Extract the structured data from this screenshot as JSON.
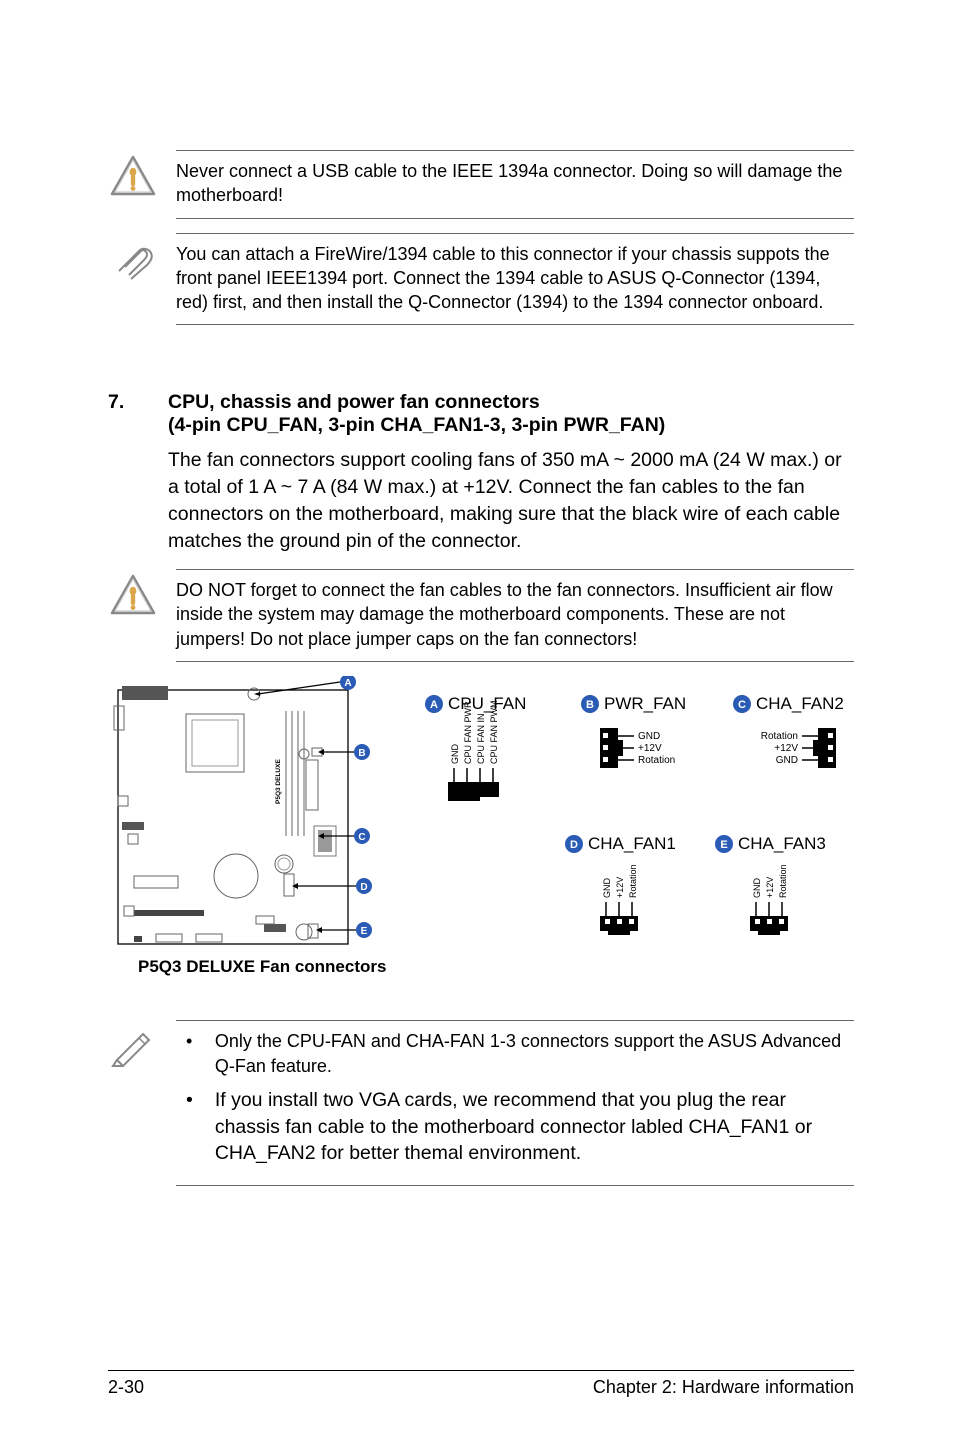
{
  "warning_usb_1394": "Never connect a USB cable to the IEEE 1394a connector. Doing so will damage the motherboard!",
  "note_firewire": "You can attach a FireWire/1394 cable to this connector if your chassis suppots the front panel IEEE1394 port. Connect the 1394 cable to ASUS Q-Connector (1394, red) first, and then install the Q-Connector (1394) to the 1394 connector onboard.",
  "section": {
    "number": "7.",
    "title_line1": "CPU, chassis and power fan connectors",
    "title_line2": "(4-pin CPU_FAN, 3-pin CHA_FAN1-3, 3-pin PWR_FAN)"
  },
  "body_fan": "The fan connectors support cooling fans of 350 mA ~ 2000 mA (24 W max.) or a total of 1 A ~ 7 A (84 W max.) at +12V. Connect the fan cables to the fan connectors on the motherboard, making sure that the black wire of each cable matches the ground pin of the connector.",
  "warning_do_not_forget": "DO NOT forget to connect the fan cables to the fan connectors. Insufficient air flow inside the system may damage the motherboard components. These are not jumpers! Do not place jumper caps on the fan connectors!",
  "figure": {
    "caption": "P5Q3 DELUXE Fan connectors",
    "board_label": "P5Q3 DELUXE",
    "callouts": [
      "A",
      "B",
      "C",
      "D",
      "E"
    ],
    "connectors": {
      "A": {
        "name": "CPU_FAN",
        "pins": [
          "GND",
          "CPU FAN PWR",
          "CPU FAN IN",
          "CPU FAN PWM"
        ]
      },
      "B": {
        "name": "PWR_FAN",
        "pins": [
          "GND",
          "+12V",
          "Rotation"
        ]
      },
      "C": {
        "name": "CHA_FAN2",
        "pins": [
          "Rotation",
          "+12V",
          "GND"
        ]
      },
      "D": {
        "name": "CHA_FAN1",
        "pins": [
          "GND",
          "+12V",
          "Rotation"
        ]
      },
      "E": {
        "name": "CHA_FAN3",
        "pins": [
          "GND",
          "+12V",
          "Rotation"
        ]
      }
    }
  },
  "note_bullets": {
    "b1": "Only the CPU-FAN and CHA-FAN 1-3 connectors support the ASUS Advanced Q-Fan feature.",
    "b2": "If you install two VGA cards, we recommend that you plug the rear chassis fan cable to the motherboard connector labled CHA_FAN1 or CHA_FAN2 for better themal environment."
  },
  "footer": {
    "page": "2-30",
    "chapter": "Chapter 2: Hardware information"
  }
}
